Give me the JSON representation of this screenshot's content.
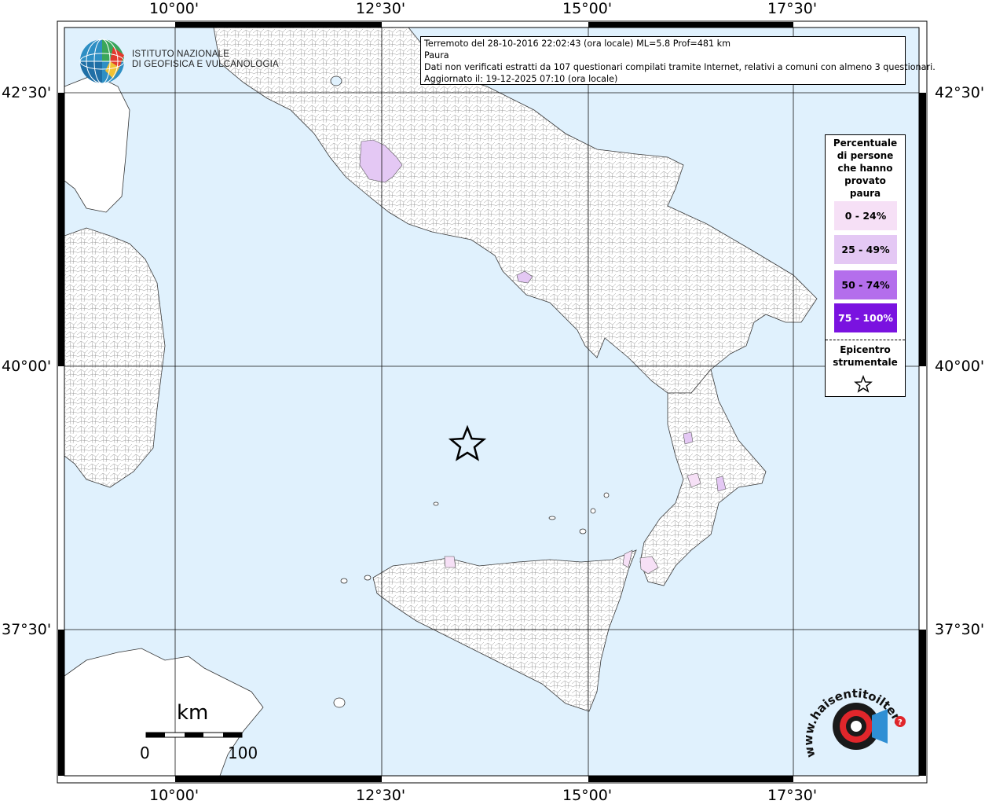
{
  "info": {
    "line1": "Terremoto del 28-10-2016 22:02:43 (ora locale) ML=5.8 Prof=481 km",
    "line2": "Paura",
    "line3": "Dati non verificati estratti da 107 questionari compilati tramite Internet, relativi a comuni con almeno 3 questionari.",
    "line4": "Aggiornato il: 19-12-2025 07:10 (ora locale)"
  },
  "institute": {
    "line1": "ISTITUTO NAZIONALE",
    "line2": "DI GEOFISICA E VULCANOLOGIA"
  },
  "axes": {
    "lon_ticks": [
      "10°00'",
      "12°30'",
      "15°00'",
      "17°30'"
    ],
    "lat_ticks": [
      "42°30'",
      "40°00'",
      "37°30'"
    ]
  },
  "legend": {
    "title_lines": [
      "Percentuale",
      "di persone",
      "che hanno",
      "provato",
      "paura"
    ],
    "classes": [
      {
        "label": "0 - 24%",
        "color": "#f6e0f6",
        "text_color": "#000000"
      },
      {
        "label": "25 - 49%",
        "color": "#e4c8f4",
        "text_color": "#000000"
      },
      {
        "label": "50 - 74%",
        "color": "#b46eec",
        "text_color": "#000000"
      },
      {
        "label": "75 - 100%",
        "color": "#7a12e0",
        "text_color": "#ffffff"
      }
    ],
    "epicenter_line1": "Epicentro",
    "epicenter_line2": "strumentale"
  },
  "scale": {
    "unit": "km",
    "start": "0",
    "end": "100"
  },
  "logo_hsit": {
    "text": "www.haisentitoilterremoto.it"
  },
  "colors": {
    "sea": "#e0f1fd",
    "land": "#ffffff",
    "border": "#000000"
  }
}
